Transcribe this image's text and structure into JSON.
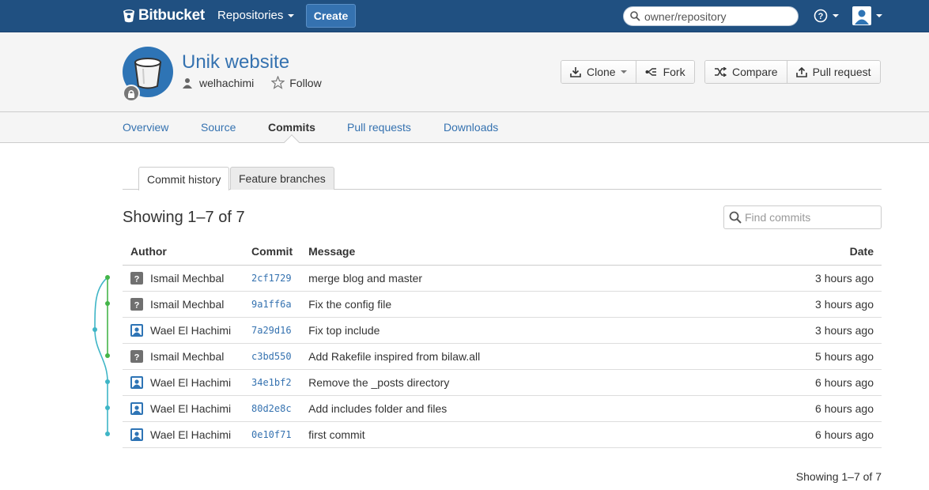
{
  "topbar": {
    "logo_text": "Bitbucket",
    "repositories_label": "Repositories",
    "create_label": "Create",
    "search_placeholder": "owner/repository",
    "help_icon": "help-icon",
    "user_icon": "user-icon",
    "bg_color": "#205081"
  },
  "repo": {
    "title": "Unik website",
    "owner": "welhachimi",
    "follow_label": "Follow",
    "clone_label": "Clone",
    "fork_label": "Fork",
    "compare_label": "Compare",
    "pull_request_label": "Pull request"
  },
  "nav": {
    "tabs": [
      {
        "label": "Overview",
        "active": false
      },
      {
        "label": "Source",
        "active": false
      },
      {
        "label": "Commits",
        "active": true
      },
      {
        "label": "Pull requests",
        "active": false
      },
      {
        "label": "Downloads",
        "active": false
      }
    ]
  },
  "subtabs": {
    "history_label": "Commit history",
    "branches_label": "Feature branches"
  },
  "main": {
    "showing": "Showing 1–7 of 7",
    "find_placeholder": "Find commits",
    "showing_bottom": "Showing 1–7 of 7"
  },
  "table": {
    "headers": {
      "author": "Author",
      "commit": "Commit",
      "message": "Message",
      "date": "Date"
    },
    "rows": [
      {
        "author": "Ismail Mechbal",
        "avatar": "unknown",
        "hash": "2cf1729",
        "message": "merge blog and master",
        "date": "3 hours ago"
      },
      {
        "author": "Ismail Mechbal",
        "avatar": "unknown",
        "hash": "9a1ff6a",
        "message": "Fix the config file",
        "date": "3 hours ago"
      },
      {
        "author": "Wael El Hachimi",
        "avatar": "user",
        "hash": "7a29d16",
        "message": "Fix top include",
        "date": "3 hours ago"
      },
      {
        "author": "Ismail Mechbal",
        "avatar": "unknown",
        "hash": "c3bd550",
        "message": "Add Rakefile inspired from bilaw.all",
        "date": "5 hours ago"
      },
      {
        "author": "Wael El Hachimi",
        "avatar": "user",
        "hash": "34e1bf2",
        "message": "Remove the _posts directory",
        "date": "6 hours ago"
      },
      {
        "author": "Wael El Hachimi",
        "avatar": "user",
        "hash": "80d2e8c",
        "message": "Add includes folder and files",
        "date": "6 hours ago"
      },
      {
        "author": "Wael El Hachimi",
        "avatar": "user",
        "hash": "0e10f71",
        "message": "first commit",
        "date": "6 hours ago"
      }
    ]
  },
  "graph_colors": {
    "branch_green": "#44b549",
    "branch_teal": "#3eb5c6"
  }
}
